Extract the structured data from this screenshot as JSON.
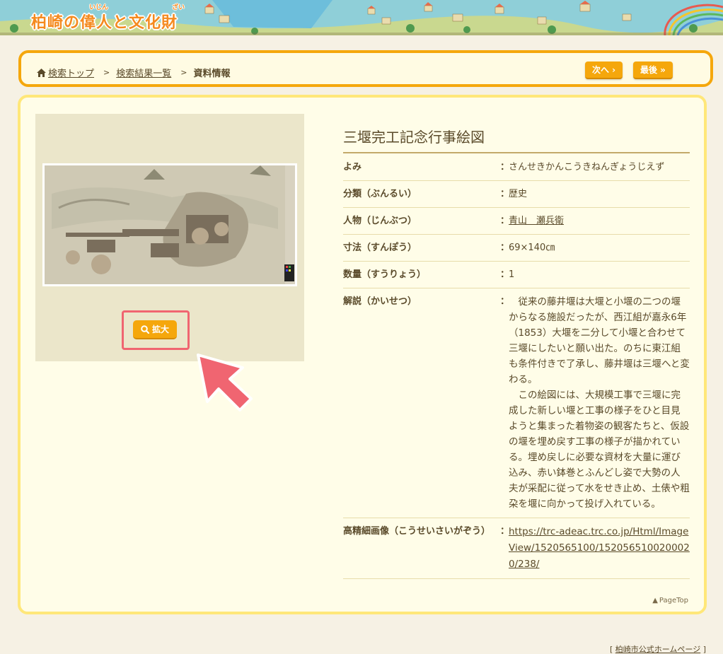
{
  "banner": {
    "title": "柏崎の偉人と文化財",
    "ruby_ijin": "いじん",
    "ruby_zai": "ざい"
  },
  "breadcrumb": {
    "home": "検索トップ",
    "results": "検索結果一覧",
    "current": "資料情報",
    "separator": ">"
  },
  "nav": {
    "next": "次へ ›",
    "last": "最後 »"
  },
  "image": {
    "zoom_label": "拡大"
  },
  "detail": {
    "title": "三堰完工記念行事絵図",
    "rows": [
      {
        "label": "よみ",
        "value": "さんせきかんこうきねんぎょうじえず"
      },
      {
        "label": "分類（ぶんるい）",
        "value": "歴史"
      },
      {
        "label": "人物（じんぶつ）",
        "value": "青山　瀬兵衛"
      },
      {
        "label": "寸法（すんぽう）",
        "value": "69×140㎝"
      },
      {
        "label": "数量（すうりょう）",
        "value": "1"
      },
      {
        "label": "解説（かいせつ）",
        "value": "　従来の藤井堰は大堰と小堰の二つの堰からなる施設だったが、西江組が嘉永6年（1853）大堰を二分して小堰と合わせて三堰にしたいと願い出た。のちに東江組も条件付きで了承し、藤井堰は三堰へと変わる。\n　この絵図には、大規模工事で三堰に完成した新しい堰と工事の様子をひと目見ようと集まった着物姿の観客たちと、仮設の堰を埋め戻す工事の様子が描かれている。埋め戻しに必要な資材を大量に運び込み、赤い鉢巻とふんどし姿で大勢の人夫が采配に従って水をせき止め、土俵や粗朶を堰に向かって投げ入れている。"
      },
      {
        "label": "高精細画像（こうせいさいがぞう）",
        "value": "https://trc-adeac.trc.co.jp/Html/ImageView/1520565100/1520565100200020/238/"
      }
    ],
    "colon": "："
  },
  "pagetop": "PageTop",
  "footer": {
    "link": "柏崎市公式ホームページ"
  },
  "colors": {
    "accent": "#f5a70c",
    "border_yellow": "#ffe779",
    "highlight": "#f06571",
    "text": "#5a4a2a"
  }
}
